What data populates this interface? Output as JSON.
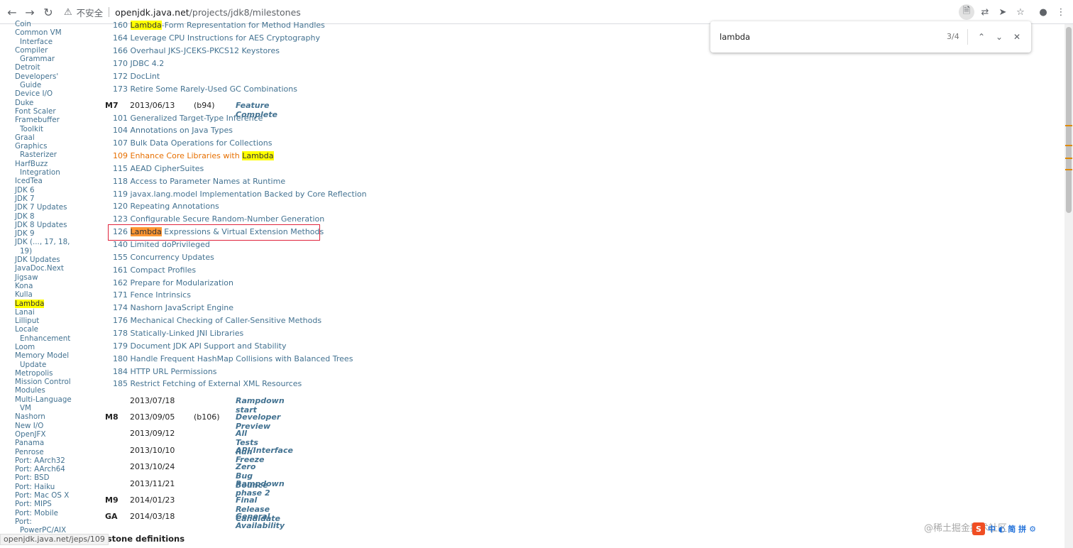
{
  "browser": {
    "insecure_label": "不安全",
    "url_host": "openjdk.java.net",
    "url_path": "/projects/jdk8/milestones"
  },
  "icons": {
    "back": "arrow-left-icon",
    "forward": "arrow-right-icon",
    "reload": "reload-icon",
    "warning": "warning-icon",
    "page": "page-icon",
    "translate": "translate-icon",
    "send": "send-icon",
    "bookmark": "star-icon",
    "profile": "profile-icon",
    "prev": "chevron-up-icon",
    "next": "chevron-down-icon",
    "close": "close-icon"
  },
  "find": {
    "query": "lambda",
    "count": "3/4"
  },
  "sidebar": {
    "items": [
      {
        "label": "Coin",
        "cont": ""
      },
      {
        "label": "Common VM",
        "cont": "Interface"
      },
      {
        "label": "Compiler",
        "cont": "Grammar"
      },
      {
        "label": "Detroit",
        "cont": ""
      },
      {
        "label": "Developers'",
        "cont": "Guide"
      },
      {
        "label": "Device I/O",
        "cont": ""
      },
      {
        "label": "Duke",
        "cont": ""
      },
      {
        "label": "Font Scaler",
        "cont": ""
      },
      {
        "label": "Framebuffer",
        "cont": "Toolkit"
      },
      {
        "label": "Graal",
        "cont": ""
      },
      {
        "label": "Graphics",
        "cont": "Rasterizer"
      },
      {
        "label": "HarfBuzz",
        "cont": "Integration"
      },
      {
        "label": "IcedTea",
        "cont": ""
      },
      {
        "label": "JDK 6",
        "cont": ""
      },
      {
        "label": "JDK 7",
        "cont": ""
      },
      {
        "label": "JDK 7 Updates",
        "cont": ""
      },
      {
        "label": "JDK 8",
        "cont": ""
      },
      {
        "label": "JDK 8 Updates",
        "cont": ""
      },
      {
        "label": "JDK 9",
        "cont": ""
      },
      {
        "label": "JDK (..., 17, 18,",
        "cont": "19)"
      },
      {
        "label": "JDK Updates",
        "cont": ""
      },
      {
        "label": "JavaDoc.Next",
        "cont": ""
      },
      {
        "label": "Jigsaw",
        "cont": ""
      },
      {
        "label": "Kona",
        "cont": ""
      },
      {
        "label": "Kulla",
        "cont": ""
      },
      {
        "label": "Lambda",
        "cont": "",
        "highlight": true
      },
      {
        "label": "Lanai",
        "cont": ""
      },
      {
        "label": "Lilliput",
        "cont": ""
      },
      {
        "label": "Locale",
        "cont": "Enhancement"
      },
      {
        "label": "Loom",
        "cont": ""
      },
      {
        "label": "Memory Model",
        "cont": "Update"
      },
      {
        "label": "Metropolis",
        "cont": ""
      },
      {
        "label": "Mission Control",
        "cont": ""
      },
      {
        "label": "Modules",
        "cont": ""
      },
      {
        "label": "Multi-Language",
        "cont": "VM"
      },
      {
        "label": "Nashorn",
        "cont": ""
      },
      {
        "label": "New I/O",
        "cont": ""
      },
      {
        "label": "OpenJFX",
        "cont": ""
      },
      {
        "label": "Panama",
        "cont": ""
      },
      {
        "label": "Penrose",
        "cont": ""
      },
      {
        "label": "Port: AArch32",
        "cont": ""
      },
      {
        "label": "Port: AArch64",
        "cont": ""
      },
      {
        "label": "Port: BSD",
        "cont": ""
      },
      {
        "label": "Port: Haiku",
        "cont": ""
      },
      {
        "label": "Port: Mac OS X",
        "cont": ""
      },
      {
        "label": "Port: MIPS",
        "cont": ""
      },
      {
        "label": "Port: Mobile",
        "cont": ""
      },
      {
        "label": "Port:",
        "cont": "PowerPC/AIX"
      }
    ]
  },
  "jeps_top": [
    {
      "num": "160",
      "pre": "",
      "hit": "Lambda",
      "post": "-Form Representation for Method Handles"
    },
    {
      "num": "164",
      "pre": "Leverage CPU Instructions for AES Cryptography",
      "hit": "",
      "post": ""
    },
    {
      "num": "166",
      "pre": "Overhaul JKS-JCEKS-PKCS12 Keystores",
      "hit": "",
      "post": ""
    },
    {
      "num": "170",
      "pre": "JDBC 4.2",
      "hit": "",
      "post": ""
    },
    {
      "num": "172",
      "pre": "DocLint",
      "hit": "",
      "post": ""
    },
    {
      "num": "173",
      "pre": "Retire Some Rarely-Used GC Combinations",
      "hit": "",
      "post": ""
    }
  ],
  "m7": {
    "label": "M7",
    "date": "2013/06/13",
    "build": "(b94)",
    "name": "Feature Complete"
  },
  "jeps_m7": [
    {
      "num": "101",
      "pre": "Generalized Target-Type Inference",
      "hit": "",
      "post": ""
    },
    {
      "num": "104",
      "pre": "Annotations on Java Types",
      "hit": "",
      "post": ""
    },
    {
      "num": "107",
      "pre": "Bulk Data Operations for Collections",
      "hit": "",
      "post": ""
    },
    {
      "num": "109",
      "pre": "Enhance Core Libraries with ",
      "hit": "Lambda",
      "post": "",
      "orange": true
    },
    {
      "num": "115",
      "pre": "AEAD CipherSuites",
      "hit": "",
      "post": ""
    },
    {
      "num": "118",
      "pre": "Access to Parameter Names at Runtime",
      "hit": "",
      "post": ""
    },
    {
      "num": "119",
      "pre": "javax.lang.model Implementation Backed by Core Reflection",
      "hit": "",
      "post": ""
    },
    {
      "num": "120",
      "pre": "Repeating Annotations",
      "hit": "",
      "post": ""
    },
    {
      "num": "123",
      "pre": "Configurable Secure Random-Number Generation",
      "hit": "",
      "post": ""
    },
    {
      "num": "126",
      "pre": "",
      "hit": "Lambda",
      "post": " Expressions & Virtual Extension Methods",
      "current": true
    },
    {
      "num": "140",
      "pre": "Limited doPrivileged",
      "hit": "",
      "post": ""
    },
    {
      "num": "155",
      "pre": "Concurrency Updates",
      "hit": "",
      "post": ""
    },
    {
      "num": "161",
      "pre": "Compact Profiles",
      "hit": "",
      "post": ""
    },
    {
      "num": "162",
      "pre": "Prepare for Modularization",
      "hit": "",
      "post": ""
    },
    {
      "num": "171",
      "pre": "Fence Intrinsics",
      "hit": "",
      "post": ""
    },
    {
      "num": "174",
      "pre": "Nashorn JavaScript Engine",
      "hit": "",
      "post": ""
    },
    {
      "num": "176",
      "pre": "Mechanical Checking of Caller-Sensitive Methods",
      "hit": "",
      "post": ""
    },
    {
      "num": "178",
      "pre": "Statically-Linked JNI Libraries",
      "hit": "",
      "post": ""
    },
    {
      "num": "179",
      "pre": "Document JDK API Support and Stability",
      "hit": "",
      "post": ""
    },
    {
      "num": "180",
      "pre": "Handle Frequent HashMap Collisions with Balanced Trees",
      "hit": "",
      "post": ""
    },
    {
      "num": "184",
      "pre": "HTTP URL Permissions",
      "hit": "",
      "post": ""
    },
    {
      "num": "185",
      "pre": "Restrict Fetching of External XML Resources",
      "hit": "",
      "post": ""
    }
  ],
  "milestones": [
    {
      "label": "",
      "date": "2013/07/18",
      "build": "",
      "name": "Rampdown start"
    },
    {
      "label": "M8",
      "date": "2013/09/05",
      "build": "(b106)",
      "name": "Developer Preview"
    },
    {
      "label": "",
      "date": "2013/09/12",
      "build": "",
      "name": "All Tests Run"
    },
    {
      "label": "",
      "date": "2013/10/10",
      "build": "",
      "name": "API/Interface Freeze"
    },
    {
      "label": "",
      "date": "2013/10/24",
      "build": "",
      "name": "Zero Bug Bounce"
    },
    {
      "label": "",
      "date": "2013/11/21",
      "build": "",
      "name": "Rampdown phase 2"
    },
    {
      "label": "M9",
      "date": "2014/01/23",
      "build": "",
      "name": "Final Release Candidate"
    },
    {
      "label": "GA",
      "date": "2014/03/18",
      "build": "",
      "name": "General Availability"
    }
  ],
  "bottom_heading": "estone definitions",
  "status_url": "openjdk.java.net/jeps/109",
  "watermark": "@稀土掘金技术社区",
  "ime": {
    "logo": "S",
    "labels": "中 ◐ 简 拼"
  },
  "colors": {
    "link": "#437291",
    "visited_orange": "#e76f00",
    "find_hit": "#ffff00",
    "find_current": "#ff9632",
    "red_box": "#e0243c"
  }
}
